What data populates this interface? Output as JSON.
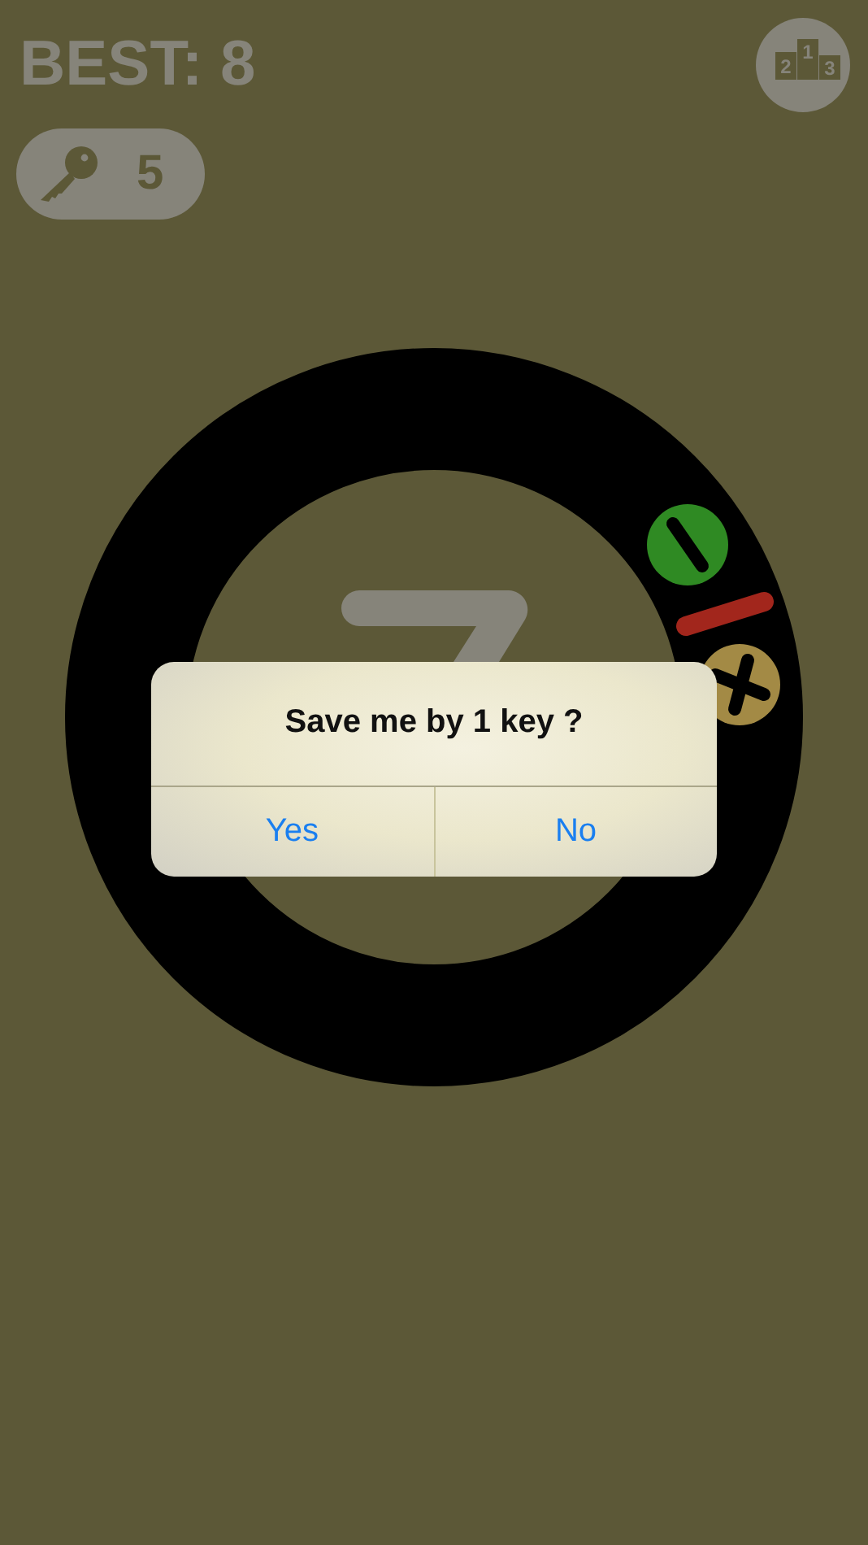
{
  "best": {
    "label": "BEST: 8"
  },
  "leaderboard_button": {
    "ranks": [
      "2",
      "1",
      "3"
    ]
  },
  "keys": {
    "count": "5"
  },
  "pieces": [
    {
      "kind": "minus"
    },
    {
      "kind": "bar"
    },
    {
      "kind": "plus"
    }
  ],
  "dialog": {
    "message": "Save me by 1 key ?",
    "buttons": [
      {
        "label": "Yes"
      },
      {
        "label": "No"
      }
    ]
  }
}
